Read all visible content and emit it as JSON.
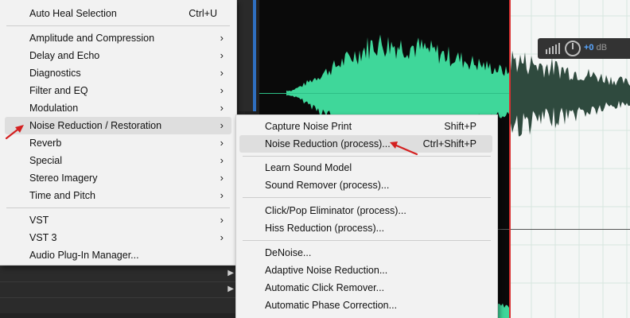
{
  "colors": {
    "waveform": "#3fd79a",
    "waveform_dark": "#2f4a3e",
    "playhead": "#d83030",
    "annotation_arrow": "#d42020",
    "menu_bg": "#f2f2f2",
    "highlight": "#dedede",
    "gain_text": "#5aa7ff"
  },
  "hud": {
    "gain_value": "+0",
    "gain_unit": "dB"
  },
  "effects_menu": {
    "items": [
      {
        "label": "Auto Heal Selection",
        "shortcut": "Ctrl+U"
      },
      {
        "label": "Amplitude and Compression",
        "submenu": true
      },
      {
        "label": "Delay and Echo",
        "submenu": true
      },
      {
        "label": "Diagnostics",
        "submenu": true
      },
      {
        "label": "Filter and EQ",
        "submenu": true
      },
      {
        "label": "Modulation",
        "submenu": true
      },
      {
        "label": "Noise Reduction / Restoration",
        "submenu": true,
        "highlighted": true
      },
      {
        "label": "Reverb",
        "submenu": true
      },
      {
        "label": "Special",
        "submenu": true
      },
      {
        "label": "Stereo Imagery",
        "submenu": true
      },
      {
        "label": "Time and Pitch",
        "submenu": true
      },
      {
        "label": "VST",
        "submenu": true
      },
      {
        "label": "VST 3",
        "submenu": true
      },
      {
        "label": "Audio Plug-In Manager..."
      }
    ]
  },
  "noise_submenu": {
    "items": [
      {
        "label": "Capture Noise Print",
        "shortcut": "Shift+P"
      },
      {
        "label": "Noise Reduction (process)...",
        "shortcut": "Ctrl+Shift+P",
        "highlighted": true
      },
      {
        "label": "Learn Sound Model"
      },
      {
        "label": "Sound Remover (process)..."
      },
      {
        "label": "Click/Pop Eliminator (process)..."
      },
      {
        "label": "Hiss Reduction (process)..."
      },
      {
        "label": "DeNoise..."
      },
      {
        "label": "Adaptive Noise Reduction..."
      },
      {
        "label": "Automatic Click Remover..."
      },
      {
        "label": "Automatic Phase Correction..."
      }
    ]
  }
}
